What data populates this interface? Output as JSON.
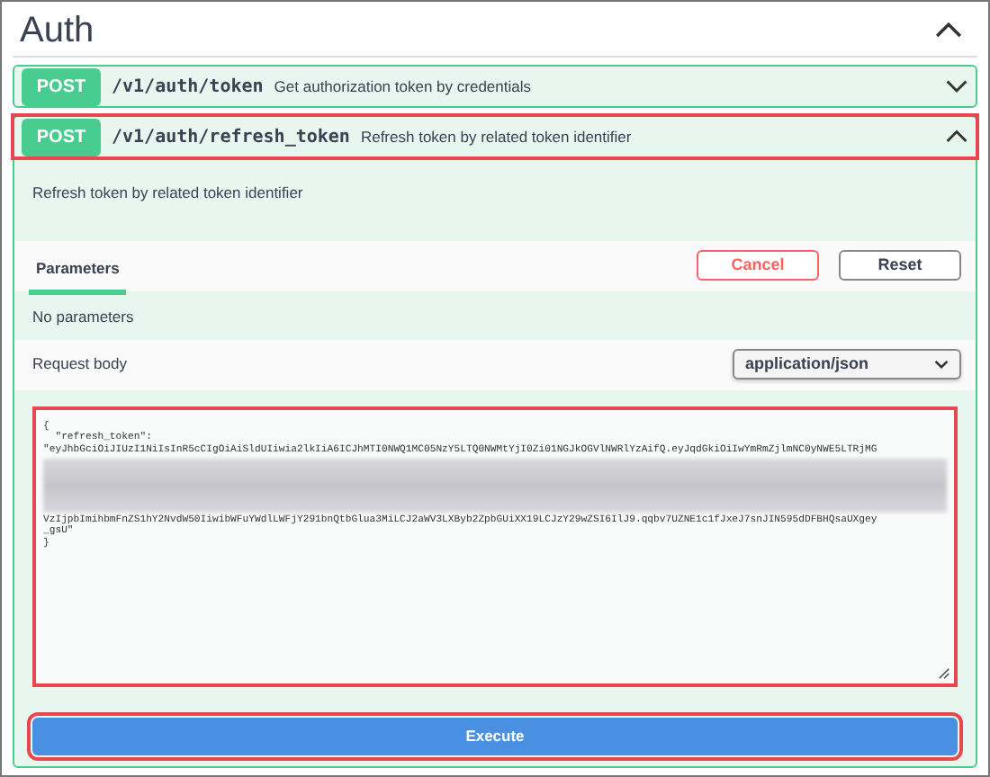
{
  "section": {
    "title": "Auth",
    "expanded": true
  },
  "operations": [
    {
      "method": "POST",
      "path": "/v1/auth/token",
      "summary": "Get authorization token by credentials",
      "expanded": false,
      "highlighted": false
    },
    {
      "method": "POST",
      "path": "/v1/auth/refresh_token",
      "summary": "Refresh token by related token identifier",
      "expanded": true,
      "highlighted": true
    }
  ],
  "details": {
    "description": "Refresh token by related token identifier",
    "tabs": [
      {
        "label": "Parameters",
        "selected": true
      }
    ],
    "cancel_button": "Cancel",
    "reset_button": "Reset",
    "no_parameters": "No parameters",
    "request_body_label": "Request body",
    "content_type": "application/json",
    "body_highlighted": true,
    "body_lines": [
      {
        "kind": "text",
        "text": "{"
      },
      {
        "kind": "text",
        "text": "  \"refresh_token\":"
      },
      {
        "kind": "text",
        "text": "\"eyJhbGciOiJIUzI1NiIsInR5cCIgOiAiSldUIiwia2lkIiA6ICJhMTI0NWQ1MC05NzY5LTQ0NWMtYjI0Zi01NGJkOGVlNWRlYzAifQ.eyJqdGkiOiIwYmRmZjlmNC0yNWE5LTRjMG"
      },
      {
        "kind": "redacted"
      },
      {
        "kind": "text",
        "text": "VzIjpbImihbmFnZS1hY2NvdW50IiwibWFuYWdlLWFjY291bnQtbGlua3MiLCJ2aWV3LXByb2ZpbGUiXX19LCJzY29wZSI6IlJ9.qqbv7UZNE1c1fJxeJ7snJIN595dDFBHQsaUXgey"
      },
      {
        "kind": "text",
        "text": "_gsU\""
      },
      {
        "kind": "text",
        "text": "}"
      }
    ],
    "execute_button": "Execute",
    "execute_highlighted": true
  }
}
